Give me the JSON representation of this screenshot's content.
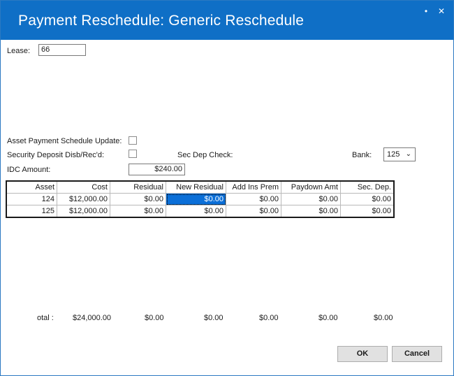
{
  "window": {
    "title": "Payment Reschedule: Generic Reschedule",
    "minimize_glyph": "•",
    "close_glyph": "✕"
  },
  "lease": {
    "label": "Lease:",
    "value": "66"
  },
  "asset_schedule_update": {
    "label": "Asset Payment Schedule Update:",
    "checked": false
  },
  "security_deposit": {
    "label": "Security Deposit Disb/Rec'd:",
    "checked": false
  },
  "sec_dep_check": {
    "label": "Sec Dep Check:"
  },
  "bank": {
    "label": "Bank:",
    "value": "125"
  },
  "idc": {
    "label": "IDC Amount:",
    "value": "$240.00"
  },
  "grid": {
    "columns": [
      "Asset",
      "Cost",
      "Residual",
      "New Residual",
      "Add Ins Prem",
      "Paydown Amt",
      "Sec. Dep."
    ],
    "rows": [
      [
        "124",
        "$12,000.00",
        "$0.00",
        "$0.00",
        "$0.00",
        "$0.00",
        "$0.00"
      ],
      [
        "125",
        "$12,000.00",
        "$0.00",
        "$0.00",
        "$0.00",
        "$0.00",
        "$0.00"
      ]
    ],
    "selected_cell": {
      "row": 0,
      "col": 3
    }
  },
  "totals": {
    "label": "otal :",
    "cost": "$24,000.00",
    "residual": "$0.00",
    "new_residual": "$0.00",
    "add_ins_prem": "$0.00",
    "paydown_amt": "$0.00",
    "sec_dep": "$0.00"
  },
  "buttons": {
    "ok": "OK",
    "cancel": "Cancel"
  },
  "colors": {
    "title_bar": "#0f6fc6",
    "selection": "#0b6fd8",
    "button_face": "#e1e1e1"
  }
}
